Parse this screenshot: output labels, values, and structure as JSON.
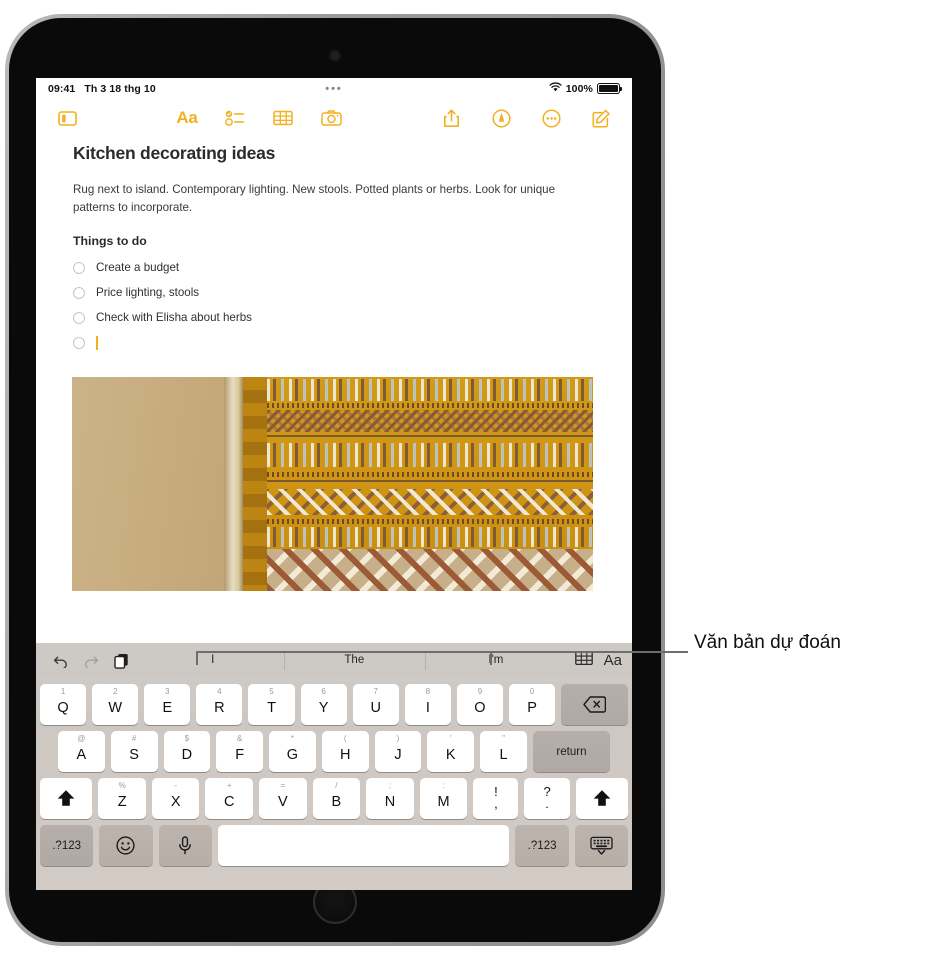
{
  "status_bar": {
    "time": "09:41",
    "date": "Th 3 18 thg 10",
    "battery_percent": "100%",
    "wifi_icon": "wifi-icon",
    "battery_icon": "battery-full-icon",
    "more_dots": "•••"
  },
  "toolbar": {
    "sidebar_toggle": "sidebar-toggle-icon",
    "format": "Aa",
    "checklist": "checklist-icon",
    "table": "table-icon",
    "camera": "camera-icon",
    "share": "share-icon",
    "markup": "markup-pen-icon",
    "more": "more-ellipsis-icon",
    "compose": "compose-icon"
  },
  "note": {
    "title": "Kitchen decorating ideas",
    "paragraph": "Rug next to island. Contemporary lighting. New stools. Potted plants or herbs. Look for unique patterns to incorporate.",
    "subheading": "Things to do",
    "todos": [
      {
        "label": "Create a budget",
        "checked": false
      },
      {
        "label": "Price lighting, stools",
        "checked": false
      },
      {
        "label": "Check with Elisha about herbs",
        "checked": false
      },
      {
        "label": "",
        "checked": false,
        "active": true
      }
    ],
    "photo_alt": "Patterned woven rug against a plaster wall"
  },
  "predictive_bar": {
    "undo_icon": "undo-icon",
    "redo_icon": "redo-icon",
    "paste_icon": "paste-icon",
    "suggestions": [
      "I",
      "The",
      "I'm"
    ],
    "table_icon": "table-icon",
    "format_label": "Aa"
  },
  "keyboard": {
    "row1": [
      {
        "sec": "1",
        "main": "Q"
      },
      {
        "sec": "2",
        "main": "W"
      },
      {
        "sec": "3",
        "main": "E"
      },
      {
        "sec": "4",
        "main": "R"
      },
      {
        "sec": "5",
        "main": "T"
      },
      {
        "sec": "6",
        "main": "Y"
      },
      {
        "sec": "7",
        "main": "U"
      },
      {
        "sec": "8",
        "main": "I"
      },
      {
        "sec": "9",
        "main": "O"
      },
      {
        "sec": "0",
        "main": "P"
      }
    ],
    "backspace_icon": "backspace-icon",
    "row2": [
      {
        "sec": "@",
        "main": "A"
      },
      {
        "sec": "#",
        "main": "S"
      },
      {
        "sec": "$",
        "main": "D"
      },
      {
        "sec": "&",
        "main": "F"
      },
      {
        "sec": "*",
        "main": "G"
      },
      {
        "sec": "(",
        "main": "H"
      },
      {
        "sec": ")",
        "main": "J"
      },
      {
        "sec": "'",
        "main": "K"
      },
      {
        "sec": "\"",
        "main": "L"
      }
    ],
    "return_label": "return",
    "row3": [
      {
        "sec": "%",
        "main": "Z"
      },
      {
        "sec": "-",
        "main": "X"
      },
      {
        "sec": "+",
        "main": "C"
      },
      {
        "sec": "=",
        "main": "V"
      },
      {
        "sec": "/",
        "main": "B"
      },
      {
        "sec": ";",
        "main": "N"
      },
      {
        "sec": ":",
        "main": "M"
      }
    ],
    "punct": [
      {
        "sec": "!",
        "main": ","
      },
      {
        "sec": "?",
        "main": "."
      }
    ],
    "shift_icon": "shift-icon",
    "bottom": {
      "numbers_left": ".?123",
      "emoji_icon": "emoji-icon",
      "mic_icon": "microphone-icon",
      "space_label": "",
      "numbers_right": ".?123",
      "dismiss_icon": "dismiss-keyboard-icon"
    }
  },
  "callout": {
    "label": "Văn bản dự đoán"
  },
  "colors": {
    "accent": "#F2B01F",
    "key_bg": "#FFFFFF",
    "keyboard_bg": "#CFCCC8",
    "text": "#2B2B2B"
  }
}
